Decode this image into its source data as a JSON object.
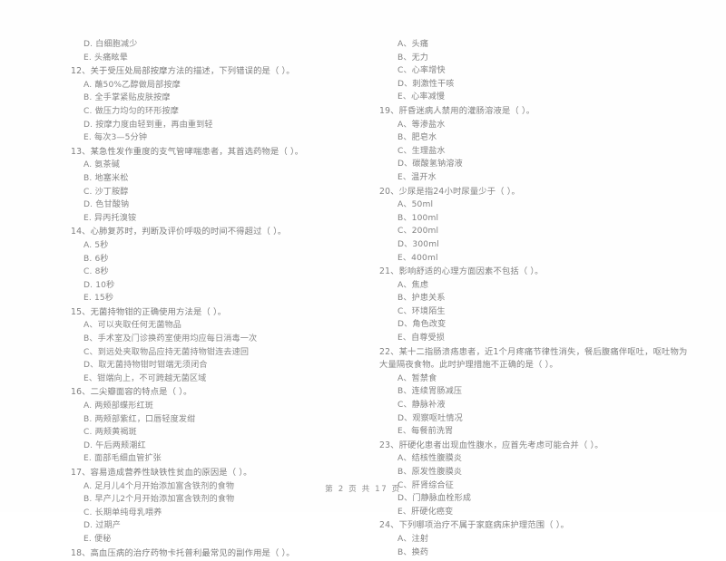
{
  "document": {
    "type": "exam-paper",
    "language": "zh-CN",
    "footer": "第 2 页 共 17 页"
  },
  "left_column": [
    {
      "number": "",
      "text": "",
      "orphan_options": [
        "D. 白细胞减少",
        "E. 头痛眩晕"
      ]
    },
    {
      "number": "12、",
      "text": "12、关于受压处局部按摩方法的描述，下列错误的是（    ）。",
      "options": [
        "A. 蘸50%乙醇做局部按摩",
        "B. 全手掌紧贴皮肤按摩",
        "C. 做压力均匀的环形按摩",
        "D. 按摩力度由轻到重，再由重到轻",
        "E. 每次3—5分钟"
      ]
    },
    {
      "number": "13、",
      "text": "13、某急性发作重度的支气管哮喘患者，其首选药物是（    ）。",
      "options": [
        "A. 氨茶碱",
        "B. 地塞米松",
        "C. 沙丁胺醇",
        "D. 色甘酸钠",
        "E. 异丙托溴铵"
      ]
    },
    {
      "number": "14、",
      "text": "14、心肺复苏时，判断及评价呼吸的时间不得超过（    ）。",
      "options": [
        "A. 5秒",
        "B. 6秒",
        "C. 8秒",
        "D. 10秒",
        "E. 15秒"
      ]
    },
    {
      "number": "15、",
      "text": "15、无菌持物钳的正确使用方法是（    ）。",
      "options": [
        "A、可以夹取任何无菌物品",
        "B、手术室及门诊换药室使用均应每日消毒一次",
        "C、到远处夹取物品应持无菌持物钳连去速回",
        "D、取无菌持物钳时钳端无须闭合",
        "E、钳端向上，不可跨越无菌区域"
      ]
    },
    {
      "number": "16、",
      "text": "16、二尖瓣面容的特点是（    ）。",
      "options": [
        "A. 两颊部蝶形红斑",
        "B. 两颊部紫红，口唇轻度发绀",
        "C. 两颊黄褐斑",
        "D. 午后两颊潮红",
        "E. 面部毛细血管扩张"
      ]
    },
    {
      "number": "17、",
      "text": "17、容易造成营养性缺铁性贫血的原因是（    ）。",
      "options": [
        "A. 足月儿4个月开始添加富含铁剂的食物",
        "B. 早产儿2个月开始添加富含铁剂的食物",
        "C. 长期单纯母乳喂养",
        "D. 过期产",
        "E. 便秘"
      ]
    },
    {
      "number": "18、",
      "text": "18、高血压病的治疗药物卡托普利最常见的副作用是（    ）。",
      "options": []
    }
  ],
  "right_column": [
    {
      "number": "",
      "text": "",
      "orphan_options": [
        "A、头痛",
        "B、无力",
        "C、心率增快",
        "D、刺激性干咳",
        "E、心率减慢"
      ]
    },
    {
      "number": "19、",
      "text": "19、肝昏迷病人禁用的灌肠溶液是（    ）。",
      "options": [
        "A、等渗盐水",
        "B、肥皂水",
        "C、生理盐水",
        "D、碳酸氢钠溶液",
        "E、温开水"
      ]
    },
    {
      "number": "20、",
      "text": "20、少尿是指24小时尿量少于（    ）。",
      "options": [
        "A、50ml",
        "B、100ml",
        "C、200ml",
        "D、300ml",
        "E、400ml"
      ]
    },
    {
      "number": "21、",
      "text": "21、影响舒适的心理方面因素不包括（    ）。",
      "options": [
        "A、焦虑",
        "B、护患关系",
        "C、环境陌生",
        "D、角色改变",
        "E、自尊受损"
      ]
    },
    {
      "number": "22、",
      "text": "22、某十二指肠溃疡患者，近1个月疼痛节律性消失，餐后腹痛伴呕吐，呕吐物为大量隔夜食物。此时护理措施不正确的是（    ）。",
      "options": [
        "A、暂禁食",
        "B、连续胃肠减压",
        "C、静脉补液",
        "D、观察呕吐情况",
        "E、每餐前洗胃"
      ]
    },
    {
      "number": "23、",
      "text": "23、肝硬化患者出现血性腹水，应首先考虑可能合并（    ）。",
      "options": [
        "A、结核性腹膜炎",
        "B、原发性腹膜炎",
        "C、肝肾综合征",
        "D、门静脉血栓形成",
        "E、肝硬化癌变"
      ]
    },
    {
      "number": "24、",
      "text": "24、下列哪项治疗不属于家庭病床护理范围（    ）。",
      "options": [
        "A、注射",
        "B、换药"
      ]
    }
  ]
}
